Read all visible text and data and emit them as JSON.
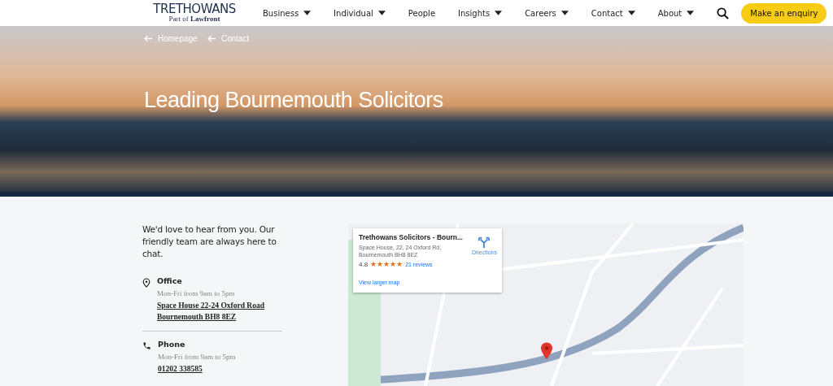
{
  "logo": {
    "name": "TRETHOWANS",
    "tagline_prefix": "Part of",
    "tagline_brand": "Lawfront"
  },
  "nav": [
    {
      "label": "Business",
      "dropdown": true
    },
    {
      "label": "Individual",
      "dropdown": true
    },
    {
      "label": "People",
      "dropdown": false
    },
    {
      "label": "Insights",
      "dropdown": true
    },
    {
      "label": "Careers",
      "dropdown": true
    },
    {
      "label": "Contact",
      "dropdown": true
    },
    {
      "label": "About",
      "dropdown": true
    }
  ],
  "cta": "Make an enquiry",
  "hero": {
    "breadcrumbs": [
      "Homepage",
      "Contact"
    ],
    "title": "Leading Bournemouth Solicitors"
  },
  "intro": "We'd love to hear from you. Our friendly team are always here to chat.",
  "contacts": [
    {
      "kind": "office",
      "title": "Office",
      "hours": "Mon-Fri from 9am to 5pm",
      "lines": [
        "Space House 22-24 Oxford Road",
        "Bournemouth BH8 8EZ"
      ]
    },
    {
      "kind": "phone",
      "title": "Phone",
      "hours": "Mon-Fri from 9am to 5pm",
      "lines": [
        "01202 338585"
      ]
    }
  ],
  "map_card": {
    "name": "Trethowans Solicitors - Bourn...",
    "address": [
      "Space House, 22, 24 Oxford Rd,",
      "Bournemouth BH8 8EZ"
    ],
    "rating": "4.8",
    "stars": 5,
    "reviews": "21 reviews",
    "directions": "Directions",
    "larger": "View larger map"
  }
}
